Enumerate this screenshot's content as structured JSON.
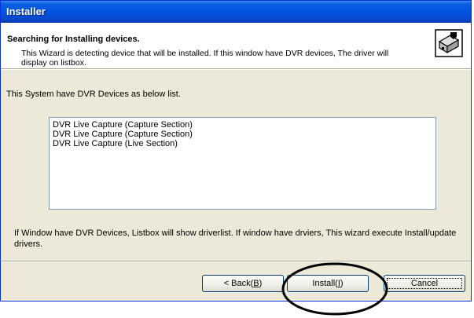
{
  "window": {
    "title": "Installer"
  },
  "header": {
    "title": "Searching for Installing devices.",
    "description": "This Wizard is detecting device that will be installed. If this window have DVR devices, The driver will display on listbox."
  },
  "body": {
    "list_label": "This System have DVR Devices as below list.",
    "devices": [
      "DVR Live Capture (Capture Section)",
      "DVR Live Capture (Capture Section)",
      "DVR Live Capture (Live Section)"
    ],
    "info_text": "If Window have DVR Devices, Listbox will show driverlist. If window have drviers, This wizard execute Install/update drivers."
  },
  "buttons": {
    "back": {
      "prefix": "< Back(",
      "key": "B",
      "suffix": ")"
    },
    "install": {
      "prefix": "Install(",
      "key": "I",
      "suffix": ")"
    },
    "cancel": "Cancel"
  },
  "colors": {
    "titlebar": "#0052e0",
    "dialog_bg": "#ece9d8",
    "border": "#0831d9"
  }
}
